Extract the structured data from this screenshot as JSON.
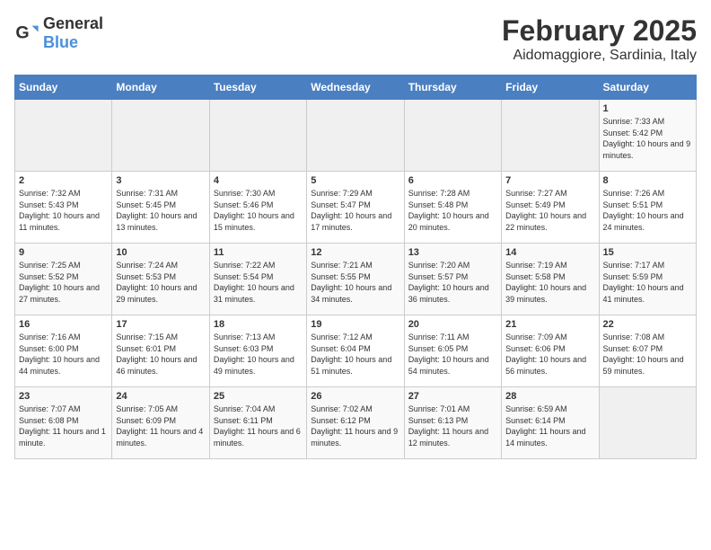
{
  "header": {
    "logo_general": "General",
    "logo_blue": "Blue",
    "title": "February 2025",
    "subtitle": "Aidomaggiore, Sardinia, Italy"
  },
  "days_of_week": [
    "Sunday",
    "Monday",
    "Tuesday",
    "Wednesday",
    "Thursday",
    "Friday",
    "Saturday"
  ],
  "weeks": [
    [
      {
        "day": "",
        "info": "",
        "empty": true
      },
      {
        "day": "",
        "info": "",
        "empty": true
      },
      {
        "day": "",
        "info": "",
        "empty": true
      },
      {
        "day": "",
        "info": "",
        "empty": true
      },
      {
        "day": "",
        "info": "",
        "empty": true
      },
      {
        "day": "",
        "info": "",
        "empty": true
      },
      {
        "day": "1",
        "info": "Sunrise: 7:33 AM\nSunset: 5:42 PM\nDaylight: 10 hours and 9 minutes."
      }
    ],
    [
      {
        "day": "2",
        "info": "Sunrise: 7:32 AM\nSunset: 5:43 PM\nDaylight: 10 hours and 11 minutes."
      },
      {
        "day": "3",
        "info": "Sunrise: 7:31 AM\nSunset: 5:45 PM\nDaylight: 10 hours and 13 minutes."
      },
      {
        "day": "4",
        "info": "Sunrise: 7:30 AM\nSunset: 5:46 PM\nDaylight: 10 hours and 15 minutes."
      },
      {
        "day": "5",
        "info": "Sunrise: 7:29 AM\nSunset: 5:47 PM\nDaylight: 10 hours and 17 minutes."
      },
      {
        "day": "6",
        "info": "Sunrise: 7:28 AM\nSunset: 5:48 PM\nDaylight: 10 hours and 20 minutes."
      },
      {
        "day": "7",
        "info": "Sunrise: 7:27 AM\nSunset: 5:49 PM\nDaylight: 10 hours and 22 minutes."
      },
      {
        "day": "8",
        "info": "Sunrise: 7:26 AM\nSunset: 5:51 PM\nDaylight: 10 hours and 24 minutes."
      }
    ],
    [
      {
        "day": "9",
        "info": "Sunrise: 7:25 AM\nSunset: 5:52 PM\nDaylight: 10 hours and 27 minutes."
      },
      {
        "day": "10",
        "info": "Sunrise: 7:24 AM\nSunset: 5:53 PM\nDaylight: 10 hours and 29 minutes."
      },
      {
        "day": "11",
        "info": "Sunrise: 7:22 AM\nSunset: 5:54 PM\nDaylight: 10 hours and 31 minutes."
      },
      {
        "day": "12",
        "info": "Sunrise: 7:21 AM\nSunset: 5:55 PM\nDaylight: 10 hours and 34 minutes."
      },
      {
        "day": "13",
        "info": "Sunrise: 7:20 AM\nSunset: 5:57 PM\nDaylight: 10 hours and 36 minutes."
      },
      {
        "day": "14",
        "info": "Sunrise: 7:19 AM\nSunset: 5:58 PM\nDaylight: 10 hours and 39 minutes."
      },
      {
        "day": "15",
        "info": "Sunrise: 7:17 AM\nSunset: 5:59 PM\nDaylight: 10 hours and 41 minutes."
      }
    ],
    [
      {
        "day": "16",
        "info": "Sunrise: 7:16 AM\nSunset: 6:00 PM\nDaylight: 10 hours and 44 minutes."
      },
      {
        "day": "17",
        "info": "Sunrise: 7:15 AM\nSunset: 6:01 PM\nDaylight: 10 hours and 46 minutes."
      },
      {
        "day": "18",
        "info": "Sunrise: 7:13 AM\nSunset: 6:03 PM\nDaylight: 10 hours and 49 minutes."
      },
      {
        "day": "19",
        "info": "Sunrise: 7:12 AM\nSunset: 6:04 PM\nDaylight: 10 hours and 51 minutes."
      },
      {
        "day": "20",
        "info": "Sunrise: 7:11 AM\nSunset: 6:05 PM\nDaylight: 10 hours and 54 minutes."
      },
      {
        "day": "21",
        "info": "Sunrise: 7:09 AM\nSunset: 6:06 PM\nDaylight: 10 hours and 56 minutes."
      },
      {
        "day": "22",
        "info": "Sunrise: 7:08 AM\nSunset: 6:07 PM\nDaylight: 10 hours and 59 minutes."
      }
    ],
    [
      {
        "day": "23",
        "info": "Sunrise: 7:07 AM\nSunset: 6:08 PM\nDaylight: 11 hours and 1 minute."
      },
      {
        "day": "24",
        "info": "Sunrise: 7:05 AM\nSunset: 6:09 PM\nDaylight: 11 hours and 4 minutes."
      },
      {
        "day": "25",
        "info": "Sunrise: 7:04 AM\nSunset: 6:11 PM\nDaylight: 11 hours and 6 minutes."
      },
      {
        "day": "26",
        "info": "Sunrise: 7:02 AM\nSunset: 6:12 PM\nDaylight: 11 hours and 9 minutes."
      },
      {
        "day": "27",
        "info": "Sunrise: 7:01 AM\nSunset: 6:13 PM\nDaylight: 11 hours and 12 minutes."
      },
      {
        "day": "28",
        "info": "Sunrise: 6:59 AM\nSunset: 6:14 PM\nDaylight: 11 hours and 14 minutes."
      },
      {
        "day": "",
        "info": "",
        "empty": true
      }
    ]
  ]
}
